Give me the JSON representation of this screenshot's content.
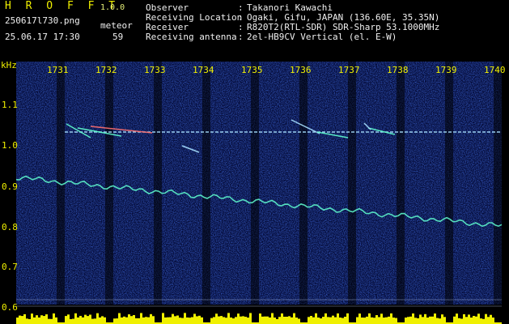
{
  "app": {
    "title": "H R O F F T",
    "version": "1.0.0"
  },
  "file": {
    "name": "250617l730.png",
    "datetime": "25.06.17 17:30"
  },
  "meteor": {
    "label": "meteor",
    "count": "59"
  },
  "info": [
    {
      "label": "Observer",
      "value": "Takanori Kawachi"
    },
    {
      "label": "Receiving Location",
      "value": "Ogaki, Gifu, JAPAN (136.60E, 35.35N)"
    },
    {
      "label": "Receiver",
      "value": "R820T2(RTL-SDR) SDR-Sharp 53.1000MHz"
    },
    {
      "label": "Receiving antenna",
      "value": "2el-HB9CV Vertical (el. E-W)"
    }
  ],
  "info_separator": ":",
  "axis": {
    "unit": "kHz",
    "y_ticks": [
      "1.1",
      "1.0",
      "0.9",
      "0.8",
      "0.7",
      "0.6"
    ],
    "x_ticks": [
      "1731",
      "1732",
      "1733",
      "1734",
      "1735",
      "1736",
      "1737",
      "1738",
      "1739",
      "1740"
    ]
  },
  "colors": {
    "text_yellow": "#f0f000",
    "text_green": "#e6f07a",
    "text_white": "#f0f0f0",
    "background": "#000000",
    "spectrogram_noise": "#0a1f8c",
    "carrier_line": "#a8e0ff",
    "meteor_echo": "#ff7070",
    "signal_trace": "#60ffd0",
    "amplitude_bar": "#f0f000"
  }
}
